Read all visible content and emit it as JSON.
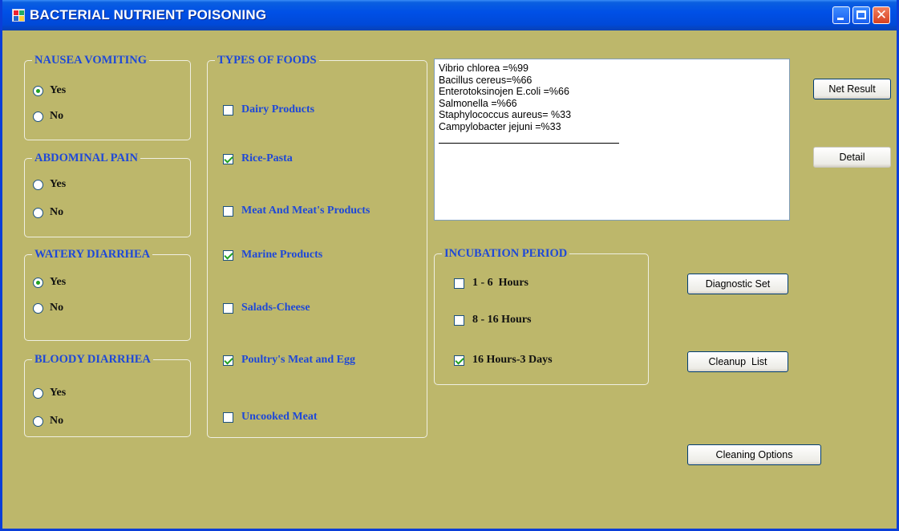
{
  "window": {
    "title": "BACTERIAL NUTRIENT POISONING"
  },
  "groups": {
    "nausea": {
      "title": "NAUSEA VOMITING",
      "yes": "Yes",
      "no": "No"
    },
    "abdominal": {
      "title": "ABDOMINAL PAIN",
      "yes": "Yes",
      "no": "No"
    },
    "watery": {
      "title": "WATERY DIARRHEA",
      "yes": "Yes",
      "no": "No"
    },
    "bloody": {
      "title": "BLOODY DIARRHEA",
      "yes": "Yes",
      "no": "No"
    }
  },
  "selections": {
    "nausea": "Yes",
    "abdominal": null,
    "watery": "Yes",
    "bloody": null
  },
  "foods": {
    "title": "TYPES OF FOODS",
    "items": [
      {
        "label": "Dairy Products",
        "checked": false
      },
      {
        "label": "Rice-Pasta",
        "checked": true
      },
      {
        "label": "Meat And Meat's Products",
        "checked": false
      },
      {
        "label": "Marine Products",
        "checked": true
      },
      {
        "label": "Salads-Cheese",
        "checked": false
      },
      {
        "label": "Poultry's Meat and Egg",
        "checked": true
      },
      {
        "label": "Uncooked Meat",
        "checked": false
      }
    ]
  },
  "results": {
    "lines": [
      "Vibrio chlorea =%99",
      "Bacillus cereus=%66",
      "Enterotoksinojen E.coli =%66",
      "Salmonella =%66",
      "Staphylococcus aureus= %33",
      "Campylobacter jejuni =%33"
    ]
  },
  "incubation": {
    "title": "INCUBATION PERIOD",
    "items": [
      {
        "label": "1 - 6  Hours",
        "checked": false
      },
      {
        "label": "8 - 16 Hours",
        "checked": false
      },
      {
        "label": "16 Hours-3 Days",
        "checked": true
      }
    ]
  },
  "buttons": {
    "net_result": "Net Result",
    "detail": "Detail",
    "diagnostic_set": "Diagnostic Set",
    "cleanup_list": "Cleanup  List",
    "cleaning_options": "Cleaning Options"
  },
  "colors": {
    "form_background": "#bdb76b",
    "group_title": "#1e48d8",
    "titlebar": "#0050e6",
    "check_mark": "#21a121"
  }
}
